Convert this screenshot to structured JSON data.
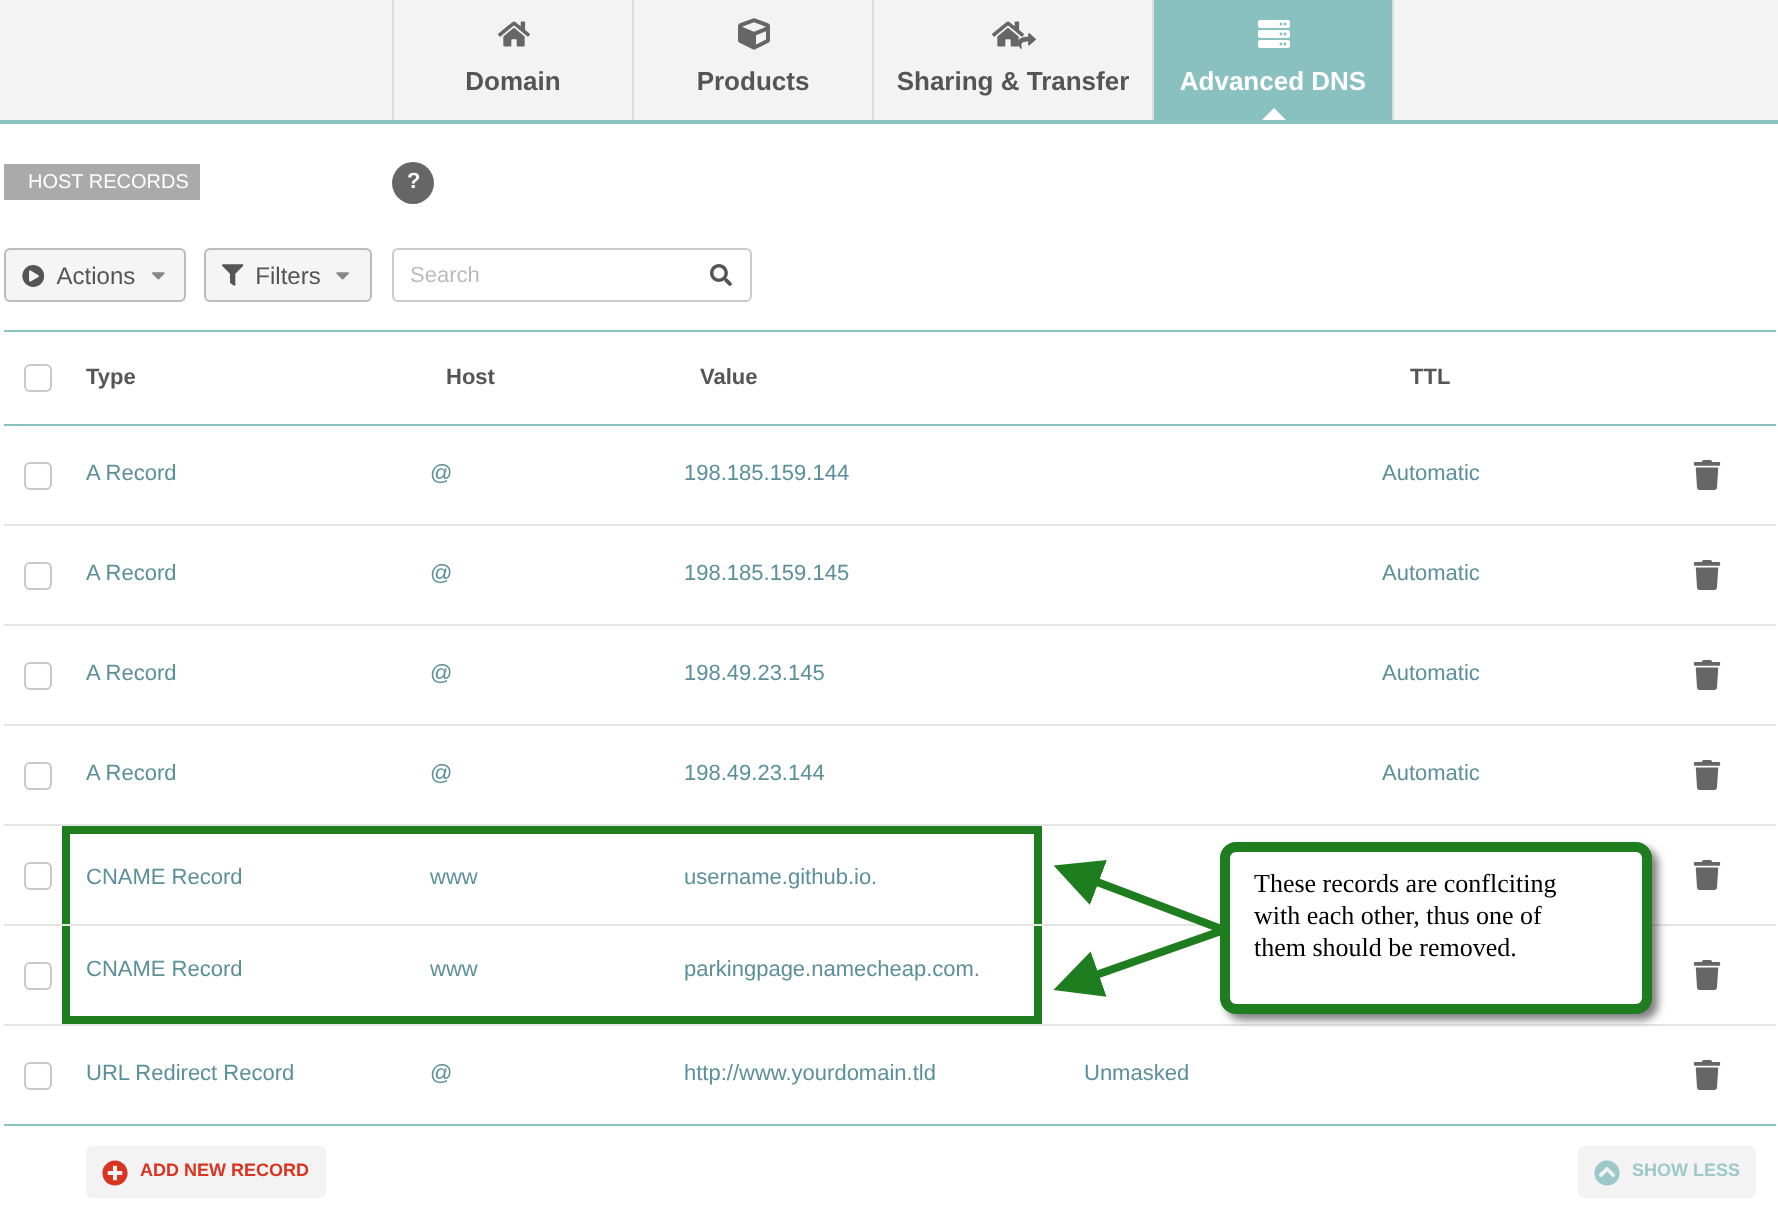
{
  "tabs": [
    {
      "label": "Domain",
      "selected": false
    },
    {
      "label": "Products",
      "selected": false
    },
    {
      "label": "Sharing & Transfer",
      "selected": false
    },
    {
      "label": "Advanced DNS",
      "selected": true
    }
  ],
  "section": {
    "label": "HOST RECORDS",
    "help": "?"
  },
  "toolbar": {
    "actions": "Actions",
    "filters": "Filters",
    "search": {
      "placeholder": "Search"
    }
  },
  "table": {
    "select_all": {
      "checked": false
    },
    "columns": [
      "Type",
      "Host",
      "Value",
      "TTL"
    ],
    "rows": [
      {
        "checked": false,
        "highlighted": false,
        "type": "A Record",
        "host": "@",
        "value": "198.185.159.144",
        "ttl": "Automatic"
      },
      {
        "checked": false,
        "highlighted": false,
        "type": "A Record",
        "host": "@",
        "value": "198.185.159.145",
        "ttl": "Automatic"
      },
      {
        "checked": false,
        "highlighted": false,
        "type": "A Record",
        "host": "@",
        "value": "198.49.23.145",
        "ttl": "Automatic"
      },
      {
        "checked": false,
        "highlighted": false,
        "type": "A Record",
        "host": "@",
        "value": "198.49.23.144",
        "ttl": "Automatic"
      },
      {
        "checked": false,
        "highlighted": true,
        "type": "CNAME Record",
        "host": "www",
        "value": "username.github.io."
      },
      {
        "checked": false,
        "highlighted": true,
        "type": "CNAME Record",
        "host": "www",
        "value": "parkingpage.namecheap.com."
      },
      {
        "checked": false,
        "highlighted": false,
        "type": "URL Redirect Record",
        "host": "@",
        "value": "http://www.yourdomain.tld",
        "column_4": "Unmasked"
      }
    ]
  },
  "footer": {
    "add": "ADD NEW RECORD",
    "toggle": "SHOW LESS"
  },
  "annotation": {
    "text": "These records are conflciting with each other, thus one of them should be removed."
  }
}
